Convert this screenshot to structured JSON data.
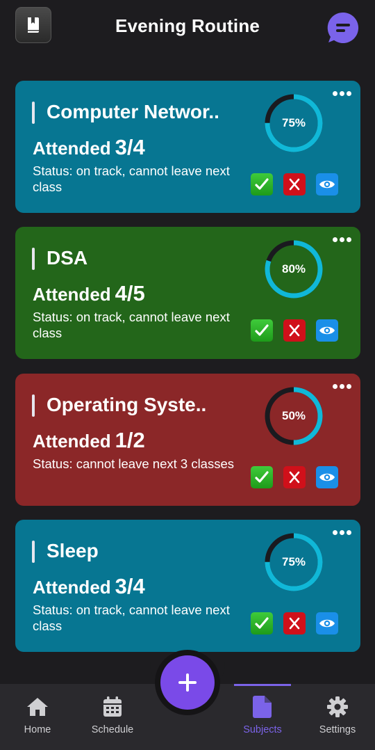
{
  "header": {
    "title": "Evening Routine"
  },
  "cards": [
    {
      "title": "Computer Networ..",
      "attended_label": "Attended",
      "attended_value": "3/4",
      "status": "Status: on track, cannot leave next class",
      "percent_label": "75%",
      "percent": 75,
      "color": "#077692"
    },
    {
      "title": "DSA",
      "attended_label": "Attended",
      "attended_value": "4/5",
      "status": "Status: on track, cannot leave next class",
      "percent_label": "80%",
      "percent": 80,
      "color": "#23661a"
    },
    {
      "title": "Operating Syste..",
      "attended_label": "Attended",
      "attended_value": "1/2",
      "status": "Status: cannot leave next 3 classes",
      "percent_label": "50%",
      "percent": 50,
      "color": "#8b2728"
    },
    {
      "title": "Sleep",
      "attended_label": "Attended",
      "attended_value": "3/4",
      "status": "Status: on track, cannot leave next class",
      "percent_label": "75%",
      "percent": 75,
      "color": "#077692"
    }
  ],
  "ring_colors": {
    "progress": "#10b8d8",
    "track": "#1a1a1f"
  },
  "nav": {
    "items": [
      {
        "label": "Home",
        "icon": "home-icon"
      },
      {
        "label": "Schedule",
        "icon": "calendar-icon"
      },
      {
        "label": "Subjects",
        "icon": "document-icon",
        "active": true
      },
      {
        "label": "Settings",
        "icon": "gear-icon"
      }
    ],
    "accent": "#7b63e8"
  },
  "fab": {
    "icon": "plus-icon",
    "color": "#7a4ae8"
  }
}
